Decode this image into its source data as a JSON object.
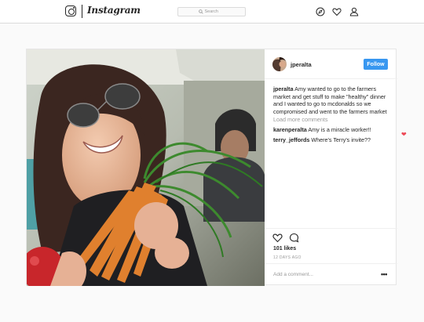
{
  "topbar": {
    "logo_text": "Instagram",
    "search_placeholder": "Search"
  },
  "post": {
    "username": "jperalta",
    "follow_label": "Follow",
    "caption_user": "jperalta",
    "caption_text": " Amy wanted to go to the farmers market and get stuff to make \"healthy\" dinner and I wanted to go to mcdonalds so we compromised and went to the farmers market",
    "load_more": "Load more comments",
    "comments": [
      {
        "user": "karenperalta",
        "text": " Amy is a miracle worker!!"
      },
      {
        "user": "terry_jeffords",
        "text": " Where's Terry's invite??"
      }
    ],
    "likes": "101 likes",
    "time": "12 DAYS AGO",
    "add_comment_placeholder": "Add a comment...",
    "more_label": "•••",
    "heart_indicator": "❤"
  },
  "colors": {
    "accent": "#3897f0",
    "heart": "#ed4956",
    "border": "#dbdbdb"
  },
  "icons": [
    "instagram-glyph-icon",
    "search-icon",
    "compass-icon",
    "heart-icon",
    "user-icon",
    "like-heart-icon",
    "comment-icon",
    "more-options-icon"
  ]
}
